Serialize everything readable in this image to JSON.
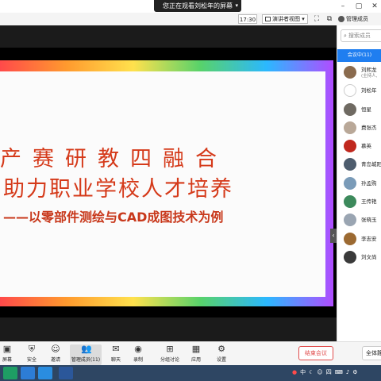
{
  "notice": "您正在观看刘松年的屏幕",
  "toolbar": {
    "clock": "17:30",
    "view_label": "演讲者视图",
    "manage_members_label": "管理成员"
  },
  "slide": {
    "line1": "产赛研教四融合",
    "line2": "助力职业学校人才培养",
    "line3": "——以零部件测绘与CAD成图技术为例"
  },
  "panel": {
    "search_placeholder": "搜索成员",
    "tab_label": "会议中(11)",
    "participants": [
      {
        "name": "刘熙龙",
        "sub": "(主持人, ",
        "avatar_color": "#8a6b4e"
      },
      {
        "name": "刘松年",
        "sub": "",
        "avatar_color": "#ffffff"
      },
      {
        "name": "恒星",
        "sub": "",
        "avatar_color": "#6f6a62"
      },
      {
        "name": "费张杰",
        "sub": "",
        "avatar_color": "#b9a898"
      },
      {
        "name": "慕英",
        "sub": "",
        "avatar_color": "#c0281e"
      },
      {
        "name": "青岛城阳",
        "sub": "",
        "avatar_color": "#4e5d6e"
      },
      {
        "name": "孙孟购",
        "sub": "",
        "avatar_color": "#7a9bb8"
      },
      {
        "name": "王传艳",
        "sub": "",
        "avatar_color": "#3d8a5c"
      },
      {
        "name": "张晓玉",
        "sub": "",
        "avatar_color": "#9aa5b2"
      },
      {
        "name": "李志安",
        "sub": "",
        "avatar_color": "#9c6a32"
      },
      {
        "name": "刘文尚",
        "sub": "",
        "avatar_color": "#3a3a3a"
      }
    ]
  },
  "bottom": {
    "items": [
      {
        "label": "屏幕",
        "icon": "share-screen-icon"
      },
      {
        "label": "安全",
        "icon": "shield-icon"
      },
      {
        "label": "邀请",
        "icon": "invite-icon"
      },
      {
        "label": "管理成员(11)",
        "icon": "members-icon"
      },
      {
        "label": "聊天",
        "icon": "chat-icon"
      },
      {
        "label": "录制",
        "icon": "record-icon"
      },
      {
        "label": "分组讨论",
        "icon": "breakout-icon"
      },
      {
        "label": "应用",
        "icon": "apps-icon"
      },
      {
        "label": "设置",
        "icon": "gear-icon"
      }
    ],
    "end_label": "结束会议",
    "mute_all_label": "全体静音"
  },
  "taskbar": {
    "tray_lang": "中",
    "tray_extra": "四"
  },
  "colors": {
    "accent": "#1f7ef0",
    "end_red": "#e04b4b",
    "title_red": "#d53a1a",
    "taskbar": "#2e4663"
  }
}
